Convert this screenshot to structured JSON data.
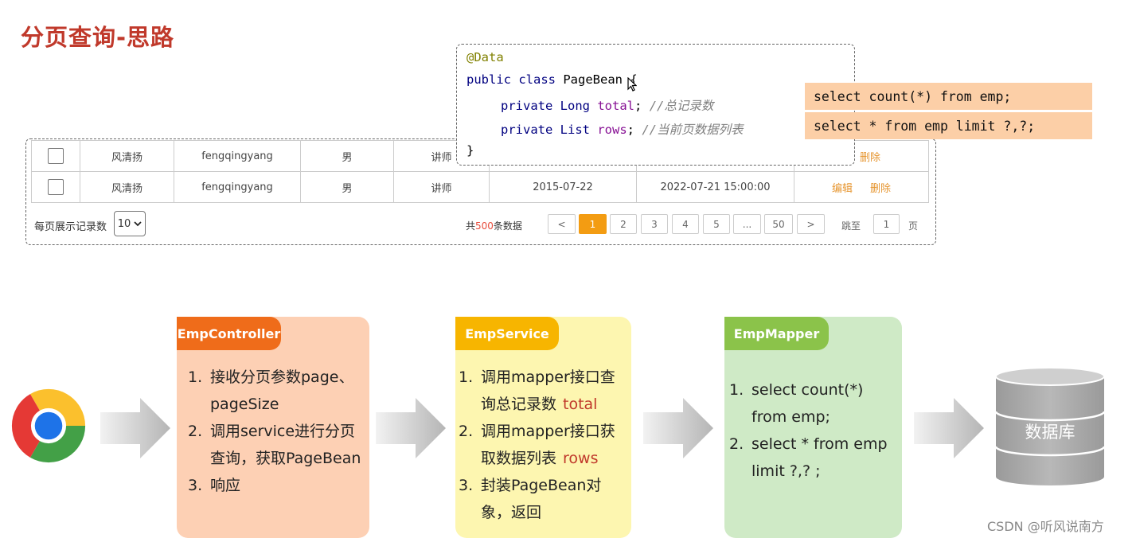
{
  "title": "分页查询-思路",
  "table": {
    "rows": [
      {
        "name": "风清扬",
        "username": "fengqingyang",
        "gender": "男",
        "job": "讲师",
        "entry_date": "",
        "update_time": "",
        "edit": "",
        "delete": "删除"
      },
      {
        "name": "风清扬",
        "username": "fengqingyang",
        "gender": "男",
        "job": "讲师",
        "entry_date": "2015-07-22",
        "update_time": "2022-07-21 15:00:00",
        "edit": "编辑",
        "delete": "删除"
      }
    ]
  },
  "pager": {
    "page_size_label": "每页展示记录数",
    "page_size_value": "10",
    "total_prefix": "共",
    "total_count": "500",
    "total_suffix": "条数据",
    "prev": "<",
    "pages": [
      "1",
      "2",
      "3",
      "4",
      "5",
      "...",
      "50"
    ],
    "active_page": "1",
    "next": ">",
    "jump_label": "跳至",
    "jump_value": "1",
    "jump_suffix": "页"
  },
  "code": {
    "annotation": "@Data",
    "class_decl_kw": "public class",
    "class_name": "PageBean {",
    "field1_type": "private Long",
    "field1_name": "total",
    "field1_end": ";",
    "field1_comment": "//总记录数",
    "field2_type": "private List",
    "field2_name": "rows",
    "field2_end": ";",
    "field2_comment": "//当前页数据列表",
    "close": "}"
  },
  "sql": {
    "count": "select count(*) from emp;",
    "page": "select * from emp limit ?,?;"
  },
  "flow": {
    "browser_icon": "chrome-icon",
    "controller": {
      "name": "EmpController",
      "items": [
        {
          "n": "1.",
          "text": "接收分页参数page、pageSize",
          "hl": ""
        },
        {
          "n": "2.",
          "text": "调用service进行分页查询，获取PageBean",
          "hl": ""
        },
        {
          "n": "3.",
          "text": "响应",
          "hl": ""
        }
      ]
    },
    "service": {
      "name": "EmpService",
      "items": [
        {
          "n": "1.",
          "text": "调用mapper接口查询总记录数",
          "hl": "total"
        },
        {
          "n": "2.",
          "text": "调用mapper接口获取数据列表",
          "hl": "rows"
        },
        {
          "n": "3.",
          "text": "封装PageBean对象，返回",
          "hl": ""
        }
      ]
    },
    "mapper": {
      "name": "EmpMapper",
      "items": [
        {
          "n": "1.",
          "text": "select count(*) from emp;",
          "hl": ""
        },
        {
          "n": "2.",
          "text": "select * from emp limit ?,? ;",
          "hl": ""
        }
      ]
    },
    "database": "数据库"
  },
  "watermark": "CSDN @听风说南方",
  "colors": {
    "title": "#c0392b",
    "controller_tab": "#ef6c1a",
    "controller_body": "#fdd0b4",
    "service_tab": "#f7b500",
    "service_body": "#fdf6b0",
    "mapper_tab": "#8bc34a",
    "mapper_body": "#cfeac6",
    "active_page": "#f39c12",
    "sql_bg": "#fccfa7"
  }
}
